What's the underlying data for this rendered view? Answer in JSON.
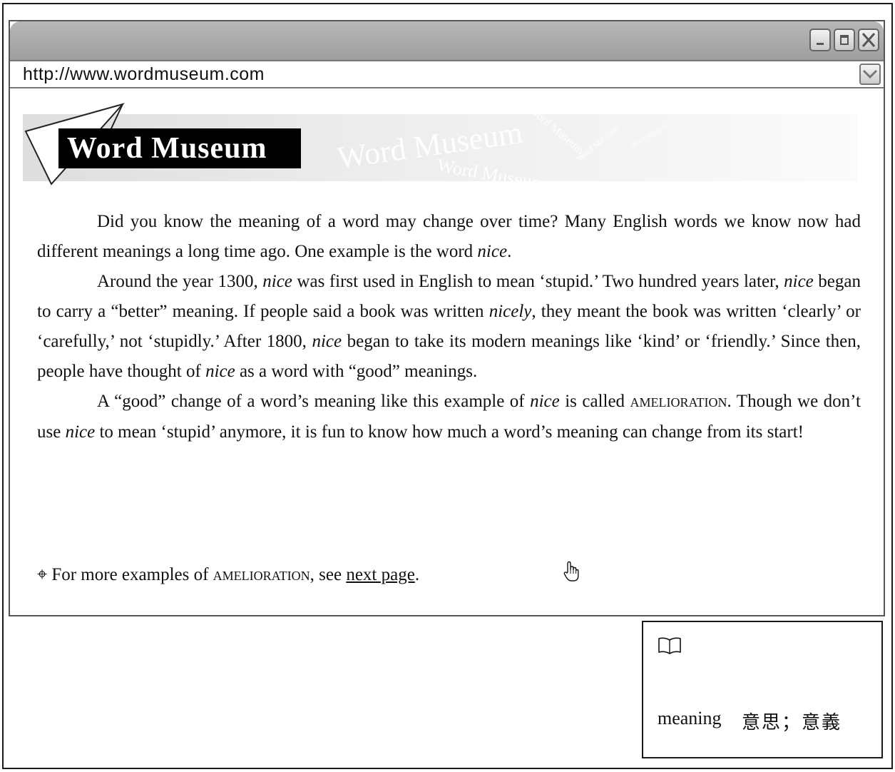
{
  "browser": {
    "url": "http://www.wordmuseum.com"
  },
  "banner": {
    "logo_text": "Word Museum",
    "watermark_large": "Word Museum",
    "watermark_small": "Word Museum"
  },
  "article": {
    "p1": {
      "s1": "Did you know the meaning of a word may change over time?   Many English words we know now had different meanings a long time ago.   One example is the word ",
      "w1": "nice",
      "s2": "."
    },
    "p2": {
      "s1": "Around the year 1300, ",
      "w1": "nice",
      "s2": " was first used in English to mean ‘stupid.’   Two hundred years later, ",
      "w2": "nice",
      "s3": " began to carry a “better” meaning.   If people said a book was written ",
      "w3": "nicely",
      "s4": ", they meant the book was written ‘clearly’ or ‘carefully,’ not ‘stupidly.’ After 1800, ",
      "w4": "nice",
      "s5": " began to take its modern meanings like ‘kind’ or ‘friendly.’   Since then, people have thought of ",
      "w5": "nice",
      "s6": " as a word with “good” meanings."
    },
    "p3": {
      "s1": "A “good” change of a word’s meaning like this example of ",
      "w1": "nice",
      "s2": " is called ",
      "term": "AMELIORATION",
      "s3": ".   Though we don’t use ",
      "w2": "nice",
      "s4": " to mean ‘stupid’ anymore, it is fun to know how much a word’s meaning can change from its start!"
    }
  },
  "more": {
    "bullet": "⌖",
    "prefix": " For more examples of ",
    "term": "AMELIORATION",
    "middle": ", see ",
    "link": "next page",
    "suffix": "."
  },
  "glossary": {
    "icon": "book-icon",
    "word": "meaning",
    "definition": "意思；意義"
  }
}
